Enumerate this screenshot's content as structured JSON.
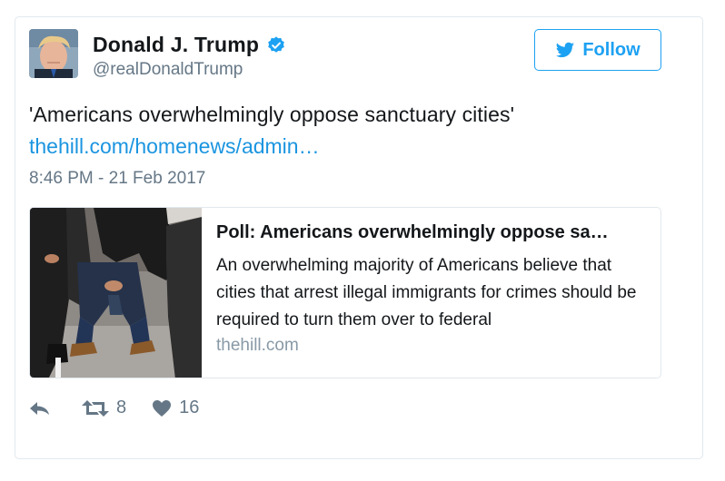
{
  "user": {
    "display_name": "Donald J. Trump",
    "handle": "@realDonaldTrump",
    "verified_icon": "verified-badge-icon"
  },
  "follow": {
    "label": "Follow",
    "icon": "twitter-bird-icon"
  },
  "tweet": {
    "text": "'Americans overwhelmingly oppose sanctuary cities'",
    "link_text": "thehill.com/homenews/admin…",
    "timestamp": "8:46 PM - 21 Feb 2017"
  },
  "card": {
    "title": "Poll: Americans overwhelmingly oppose sa…",
    "description": "An overwhelming majority of Americans believe that cities that arrest illegal immigrants for crimes should be required to turn them over to federal",
    "domain": "thehill.com"
  },
  "actions": {
    "reply_icon": "reply-icon",
    "retweet_icon": "retweet-icon",
    "retweet_count": "8",
    "like_icon": "heart-icon",
    "like_count": "16"
  },
  "colors": {
    "accent": "#1da1f2",
    "link": "#1b95e0",
    "muted": "#657786",
    "border": "#e1e8ed"
  }
}
